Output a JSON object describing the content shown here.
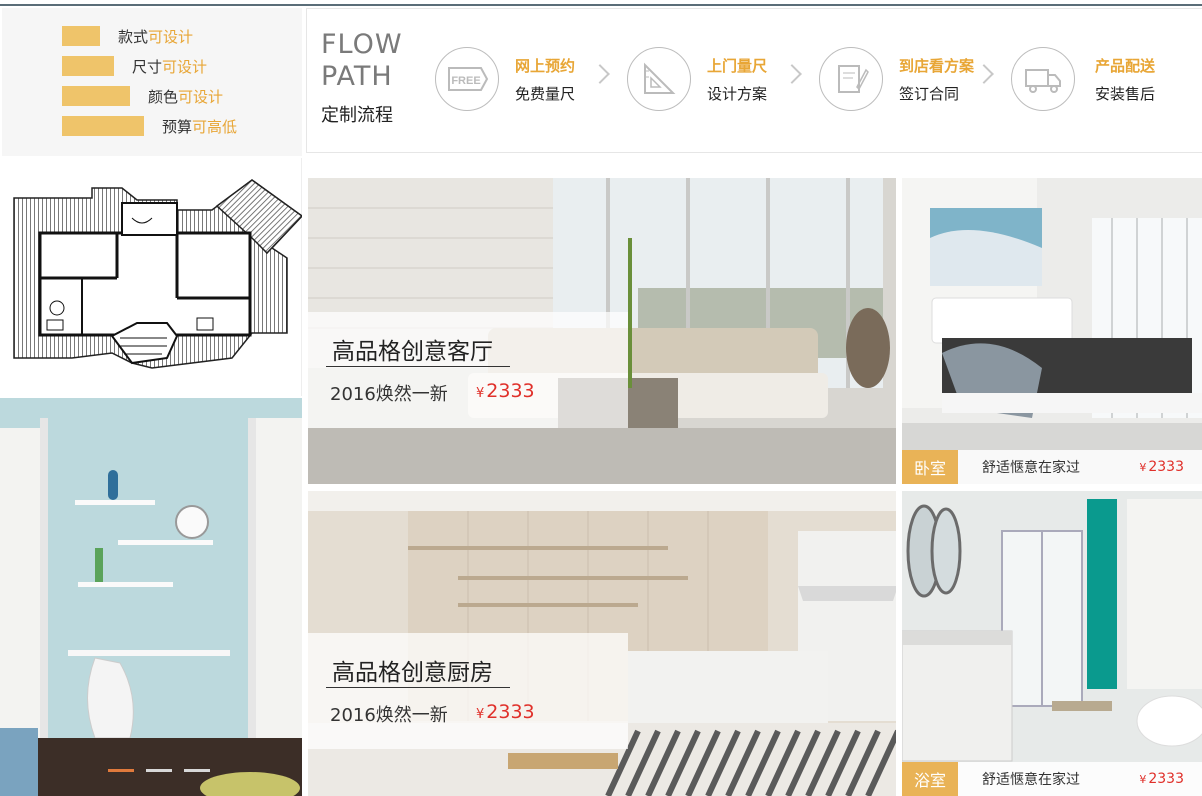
{
  "header": {
    "cut_text": ""
  },
  "tags": [
    {
      "label": "款式",
      "highlight": "可设计"
    },
    {
      "label": "尺寸",
      "highlight": "可设计"
    },
    {
      "label": "颜色",
      "highlight": "可设计"
    },
    {
      "label": "预算",
      "highlight": "可高低"
    }
  ],
  "flow": {
    "title_en_1": "FLOW",
    "title_en_2": "PATH",
    "title_cn": "定制流程",
    "steps": [
      {
        "icon": "free-tag-icon",
        "title": "网上预约",
        "desc": "免费量尺"
      },
      {
        "icon": "ruler-triangle-icon",
        "title": "上门量尺",
        "desc": "设计方案"
      },
      {
        "icon": "contract-pen-icon",
        "title": "到店看方案",
        "desc": "签订合同"
      },
      {
        "icon": "delivery-truck-icon",
        "title": "产品配送",
        "desc": "安装售后"
      }
    ],
    "icon_free_text": "FREE"
  },
  "tiles": {
    "living": {
      "title": "高品格创意客厅",
      "sub": "2016焕然一新",
      "currency": "¥",
      "price": "2333"
    },
    "kitchen": {
      "title": "高品格创意厨房",
      "sub": "2016焕然一新",
      "currency": "¥",
      "price": "2333"
    },
    "bedroom": {
      "label": "卧室",
      "text": "舒适惬意在家过",
      "currency": "¥",
      "price": "2333"
    },
    "bath": {
      "label": "浴室",
      "text": "舒适惬意在家过",
      "currency": "¥",
      "price": "2333"
    }
  },
  "carousel": {
    "count": 3,
    "active": 1
  },
  "colors": {
    "accent": "#efc46a",
    "highlight": "#e8a636",
    "price": "#e0302a"
  }
}
